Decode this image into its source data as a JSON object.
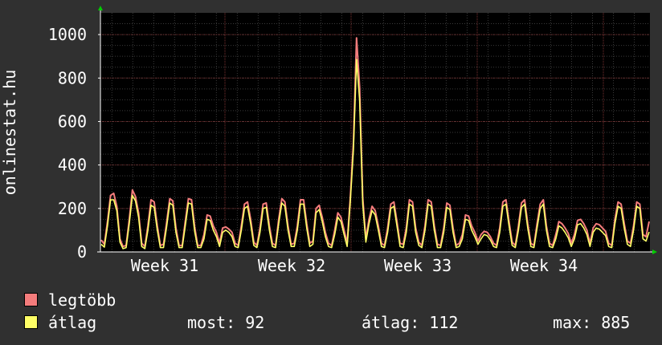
{
  "chart_data": {
    "type": "line",
    "ylabel": "onlinestat.hu",
    "x_tick_labels": [
      "Week 31",
      "Week 32",
      "Week 33",
      "Week 34"
    ],
    "y_ticks": [
      0,
      200,
      400,
      600,
      800,
      1000
    ],
    "ylim": [
      0,
      1100
    ],
    "grid": true,
    "legend_position": "bottom",
    "series": [
      {
        "name": "legtöbb",
        "color": "#f47c7c",
        "values": [
          55,
          35,
          140,
          260,
          270,
          210,
          60,
          25,
          30,
          150,
          285,
          255,
          180,
          40,
          25,
          120,
          240,
          230,
          120,
          30,
          35,
          135,
          245,
          235,
          110,
          30,
          30,
          140,
          245,
          240,
          115,
          30,
          30,
          80,
          170,
          165,
          120,
          90,
          40,
          110,
          115,
          105,
          90,
          40,
          30,
          120,
          220,
          230,
          150,
          45,
          30,
          110,
          220,
          225,
          120,
          40,
          30,
          150,
          245,
          230,
          120,
          35,
          40,
          120,
          240,
          240,
          130,
          40,
          50,
          200,
          215,
          160,
          90,
          40,
          30,
          100,
          180,
          160,
          100,
          40,
          250,
          500,
          985,
          760,
          250,
          60,
          150,
          210,
          190,
          120,
          40,
          30,
          110,
          220,
          230,
          140,
          40,
          35,
          110,
          240,
          230,
          110,
          45,
          30,
          120,
          240,
          230,
          120,
          35,
          30,
          110,
          225,
          215,
          110,
          30,
          40,
          80,
          170,
          165,
          120,
          90,
          50,
          80,
          95,
          90,
          70,
          40,
          30,
          110,
          230,
          240,
          140,
          45,
          30,
          120,
          225,
          240,
          130,
          40,
          30,
          130,
          220,
          240,
          120,
          40,
          30,
          80,
          140,
          130,
          110,
          85,
          40,
          80,
          145,
          150,
          130,
          100,
          40,
          110,
          130,
          125,
          110,
          95,
          40,
          30,
          150,
          230,
          220,
          130,
          50,
          40,
          120,
          230,
          220,
          80,
          70,
          140
        ]
      },
      {
        "name": "átlag",
        "color": "#ffff66",
        "values": [
          35,
          22,
          120,
          240,
          240,
          190,
          45,
          15,
          20,
          130,
          260,
          235,
          160,
          25,
          15,
          100,
          215,
          205,
          100,
          20,
          20,
          115,
          225,
          215,
          90,
          20,
          20,
          120,
          225,
          220,
          95,
          20,
          20,
          60,
          150,
          145,
          100,
          70,
          25,
          90,
          100,
          90,
          70,
          25,
          20,
          100,
          200,
          210,
          130,
          30,
          20,
          90,
          200,
          205,
          100,
          25,
          20,
          130,
          225,
          210,
          100,
          25,
          25,
          100,
          220,
          220,
          110,
          25,
          35,
          180,
          195,
          140,
          70,
          25,
          20,
          80,
          160,
          140,
          80,
          25,
          230,
          470,
          885,
          700,
          220,
          45,
          130,
          190,
          170,
          100,
          25,
          20,
          90,
          200,
          210,
          120,
          25,
          20,
          90,
          220,
          210,
          90,
          30,
          20,
          100,
          220,
          210,
          100,
          20,
          20,
          90,
          205,
          195,
          90,
          20,
          25,
          60,
          150,
          145,
          100,
          70,
          35,
          60,
          80,
          75,
          55,
          25,
          20,
          90,
          210,
          220,
          120,
          30,
          20,
          100,
          205,
          220,
          110,
          25,
          20,
          110,
          200,
          220,
          100,
          25,
          20,
          60,
          120,
          110,
          90,
          65,
          25,
          60,
          125,
          130,
          110,
          80,
          25,
          90,
          110,
          105,
          90,
          75,
          25,
          20,
          130,
          210,
          200,
          110,
          35,
          25,
          100,
          210,
          200,
          60,
          50,
          92
        ]
      }
    ]
  },
  "legend": {
    "max_label": "legtöbb",
    "avg_label": "átlag",
    "max_color": "#f47c7c",
    "avg_color": "#ffff66",
    "now": "most: 92",
    "average": "átlag: 112",
    "maximum": "max: 885"
  }
}
